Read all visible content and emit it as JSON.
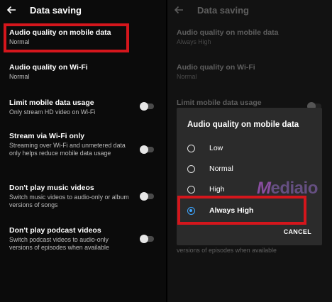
{
  "left": {
    "title": "Data saving",
    "items": [
      {
        "title": "Audio quality on mobile data",
        "sub": "Normal"
      },
      {
        "title": "Audio quality on Wi-Fi",
        "sub": "Normal"
      },
      {
        "title": "Limit mobile data usage",
        "sub": "Only stream HD video on Wi-Fi"
      },
      {
        "title": "Stream via Wi-Fi only",
        "sub": "Streaming over Wi-Fi and unmetered data only helps reduce mobile data usage"
      },
      {
        "title": "Don't play music videos",
        "sub": "Switch music videos to audio-only or album versions of songs"
      },
      {
        "title": "Don't play podcast videos",
        "sub": "Switch podcast videos to audio-only versions of episodes when available"
      }
    ]
  },
  "right": {
    "title": "Data saving",
    "items": [
      {
        "title": "Audio quality on mobile data",
        "sub": "Always High"
      },
      {
        "title": "Audio quality on Wi-Fi",
        "sub": "Normal"
      },
      {
        "title": "Limit mobile data usage",
        "sub": ""
      }
    ],
    "bottom_sub": "versions of episodes when available"
  },
  "dialog": {
    "title": "Audio quality on mobile data",
    "options": [
      "Low",
      "Normal",
      "High",
      "Always High"
    ],
    "selected": "Always High",
    "cancel": "CANCEL"
  },
  "watermark": {
    "m": "M",
    "rest": "ediaio"
  },
  "colors": {
    "highlight": "#d4161c",
    "accent": "#3ea6ff",
    "dialog_bg": "#2b2b2b"
  },
  "icons": {
    "back": "arrow-left-icon"
  }
}
